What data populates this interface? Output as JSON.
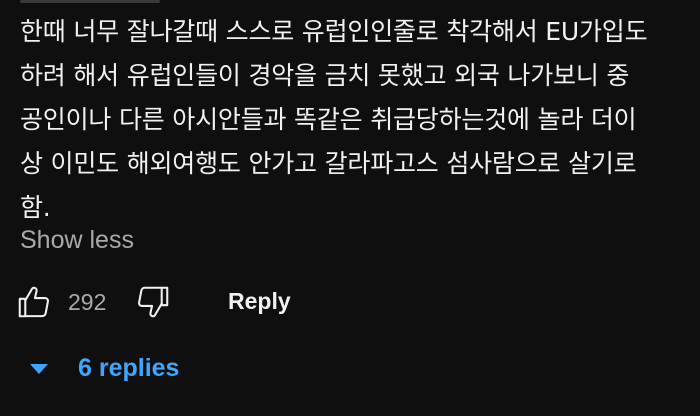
{
  "comment": {
    "text_lines": [
      "한때 너무 잘나갈때 스스로 유럽인인줄로 착각해서 EU가입도",
      "하려 해서 유럽인들이 경악을 금치 못했고 외국 나가보니 중",
      "공인이나 다른 아시안들과 똑같은 취급당하는것에 놀라 더이",
      "상 이민도 해외여행도 안가고 갈라파고스 섬사람으로 살기로",
      "함."
    ],
    "show_less_label": "Show less"
  },
  "actions": {
    "like_icon": "thumbs-up-icon",
    "like_count": "292",
    "dislike_icon": "thumbs-down-icon",
    "reply_label": "Reply"
  },
  "replies": {
    "icon": "caret-down-icon",
    "label": "6 replies",
    "accent_color": "#3ea6ff"
  },
  "colors": {
    "background": "#0f0f0f",
    "primary_text": "#f1f1f1",
    "secondary_text": "#aaaaaa"
  }
}
